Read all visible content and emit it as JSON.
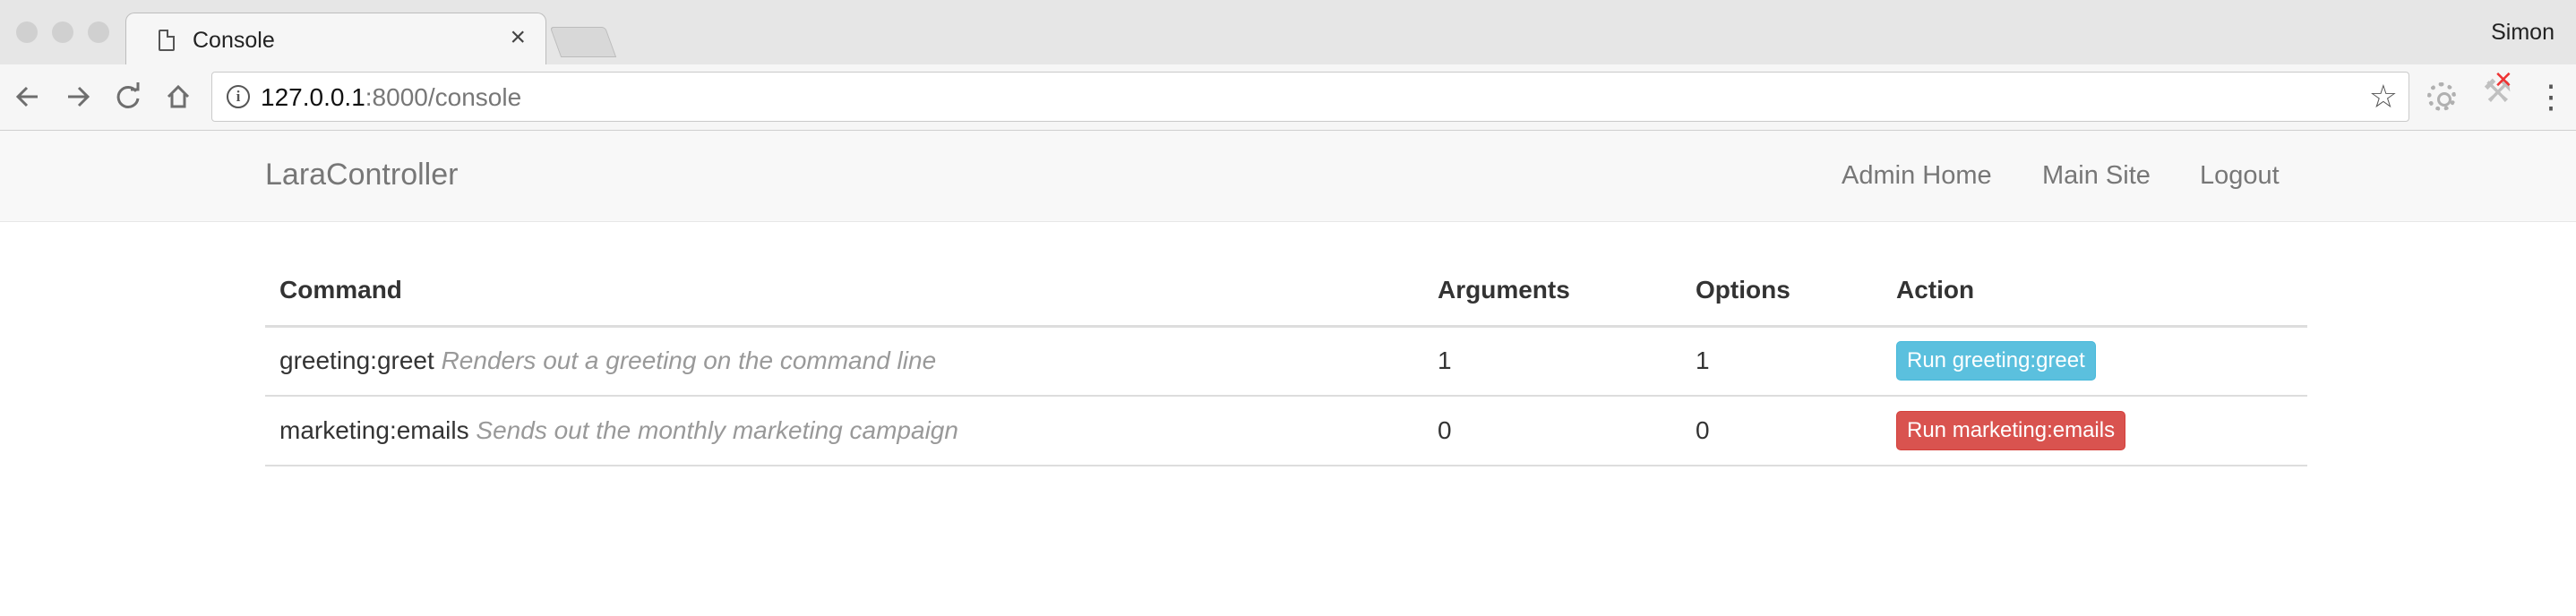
{
  "browser": {
    "tab_title": "Console",
    "tab_close": "×",
    "profile_name": "Simon",
    "url_host": "127.0.0.1",
    "url_path": ":8000/console"
  },
  "navbar": {
    "brand": "LaraController",
    "links": [
      "Admin Home",
      "Main Site",
      "Logout"
    ]
  },
  "table": {
    "headers": [
      "Command",
      "Arguments",
      "Options",
      "Action"
    ],
    "rows": [
      {
        "command": "greeting:greet",
        "description": "Renders out a greeting on the command line",
        "arguments": "1",
        "options": "1",
        "action": "Run greeting:greet",
        "action_color": "#5bc0de"
      },
      {
        "command": "marketing:emails",
        "description": "Sends out the monthly marketing campaign",
        "arguments": "0",
        "options": "0",
        "action": "Run marketing:emails",
        "action_color": "#d9534f"
      }
    ]
  },
  "icons": {
    "back": "back-arrow-icon",
    "forward": "forward-arrow-icon",
    "reload": "reload-icon",
    "home": "home-icon",
    "info": "info-icon",
    "bookmark": "star-icon",
    "menu": "menu-dots-icon"
  }
}
